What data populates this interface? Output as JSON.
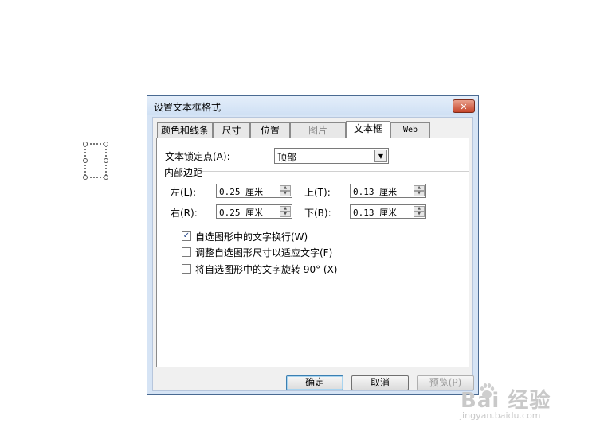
{
  "dialog": {
    "title": "设置文本框格式",
    "close_label": "✕",
    "tabs": [
      {
        "label": "颜色和线条",
        "state": "normal"
      },
      {
        "label": "尺寸",
        "state": "normal"
      },
      {
        "label": "位置",
        "state": "normal"
      },
      {
        "label": "图片",
        "state": "disabled"
      },
      {
        "label": "文本框",
        "state": "active"
      },
      {
        "label": "Web",
        "state": "normal"
      }
    ],
    "anchor": {
      "label": "文本锁定点(A):",
      "value": "顶部"
    },
    "margins": {
      "title": "内部边距",
      "left": {
        "label": "左(L):",
        "value": "0.25 厘米"
      },
      "top": {
        "label": "上(T):",
        "value": "0.13 厘米"
      },
      "right": {
        "label": "右(R):",
        "value": "0.25 厘米"
      },
      "bottom": {
        "label": "下(B):",
        "value": "0.13 厘米"
      }
    },
    "options": [
      {
        "label": "自选图形中的文字换行(W)",
        "checked": true
      },
      {
        "label": "调整自选图形尺寸以适应文字(F)",
        "checked": false
      },
      {
        "label": "将自选图形中的文字旋转 90° (X)",
        "checked": false
      }
    ],
    "buttons": {
      "ok": "确定",
      "cancel": "取消",
      "preview": "预览(P)"
    }
  },
  "watermark": {
    "brand": "Bai 经验",
    "site": "jingyan.baidu.com"
  },
  "colors": {
    "accent": "#3c7fb1",
    "close": "#c5452a",
    "frame": "#d6e4f5"
  }
}
